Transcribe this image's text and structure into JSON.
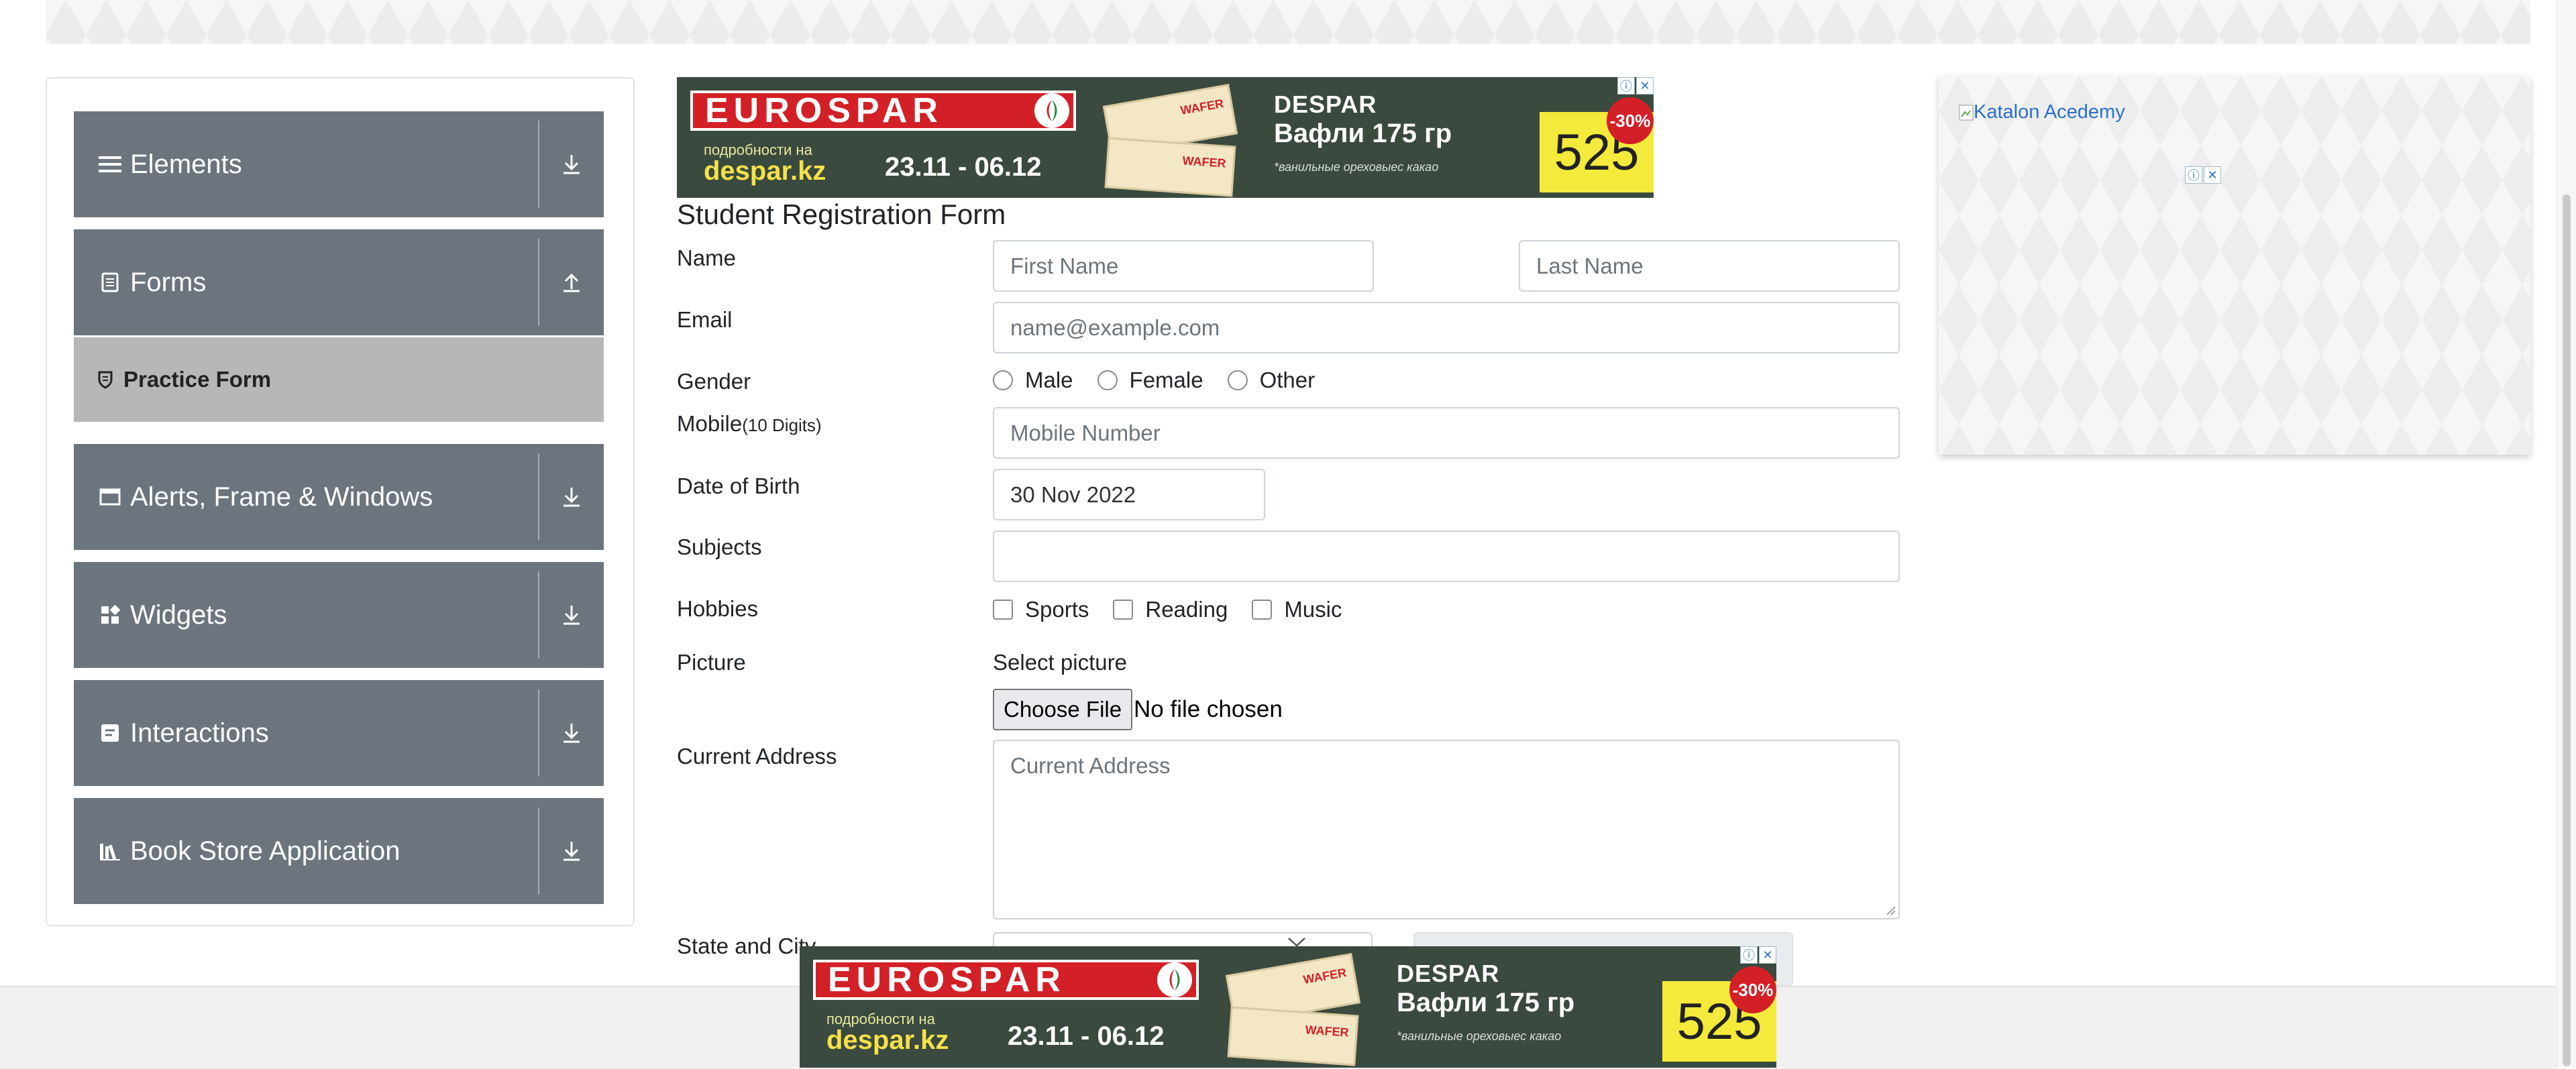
{
  "colors": {
    "sidebar_group_bg": "#6c757d",
    "sidebar_active_bg": "#b7b7b7",
    "input_border": "#ced4da",
    "link_blue": "#2b70c9",
    "ad_red": "#d32027",
    "ad_yellow": "#f3ea3b"
  },
  "sidebar": {
    "groups": [
      {
        "label": "Elements",
        "icon": "menu-icon",
        "arrow": "download-icon"
      },
      {
        "label": "Forms",
        "icon": "document-icon",
        "arrow": "upload-icon"
      },
      {
        "label": "Alerts, Frame & Windows",
        "icon": "window-icon",
        "arrow": "download-icon"
      },
      {
        "label": "Widgets",
        "icon": "widgets-icon",
        "arrow": "download-icon"
      },
      {
        "label": "Interactions",
        "icon": "interactions-icon",
        "arrow": "download-icon"
      },
      {
        "label": "Book Store Application",
        "icon": "books-icon",
        "arrow": "download-icon"
      }
    ],
    "active_item": {
      "label": "Practice Form",
      "icon": "shield-icon"
    }
  },
  "ad": {
    "brand": "EUROSPAR",
    "sub1": "подробности на",
    "sub2": "despar.kz",
    "dates": "23.11 - 06.12",
    "pack_label": "WAFER",
    "headline1": "DESPAR",
    "headline2": "Вафли 175 гр",
    "tagline": "*ванильные ореховыес какао",
    "price": "525",
    "discount": "-30%"
  },
  "form": {
    "title": "Student Registration Form",
    "name_label": "Name",
    "first_name_placeholder": "First Name",
    "last_name_placeholder": "Last Name",
    "email_label": "Email",
    "email_placeholder": "name@example.com",
    "gender_label": "Gender",
    "gender_options": [
      "Male",
      "Female",
      "Other"
    ],
    "mobile_label": "Mobile",
    "mobile_hint": "(10 Digits)",
    "mobile_placeholder": "Mobile Number",
    "dob_label": "Date of Birth",
    "dob_value": "30 Nov 2022",
    "subjects_label": "Subjects",
    "hobbies_label": "Hobbies",
    "hobbies_options": [
      "Sports",
      "Reading",
      "Music"
    ],
    "picture_label": "Picture",
    "select_picture": "Select picture",
    "choose_file": "Choose File",
    "no_file": "No file chosen",
    "address_label": "Current Address",
    "address_placeholder": "Current Address",
    "state_city_label": "State and City"
  },
  "right_ad": {
    "alt_text": "Katalon Acedemy"
  }
}
